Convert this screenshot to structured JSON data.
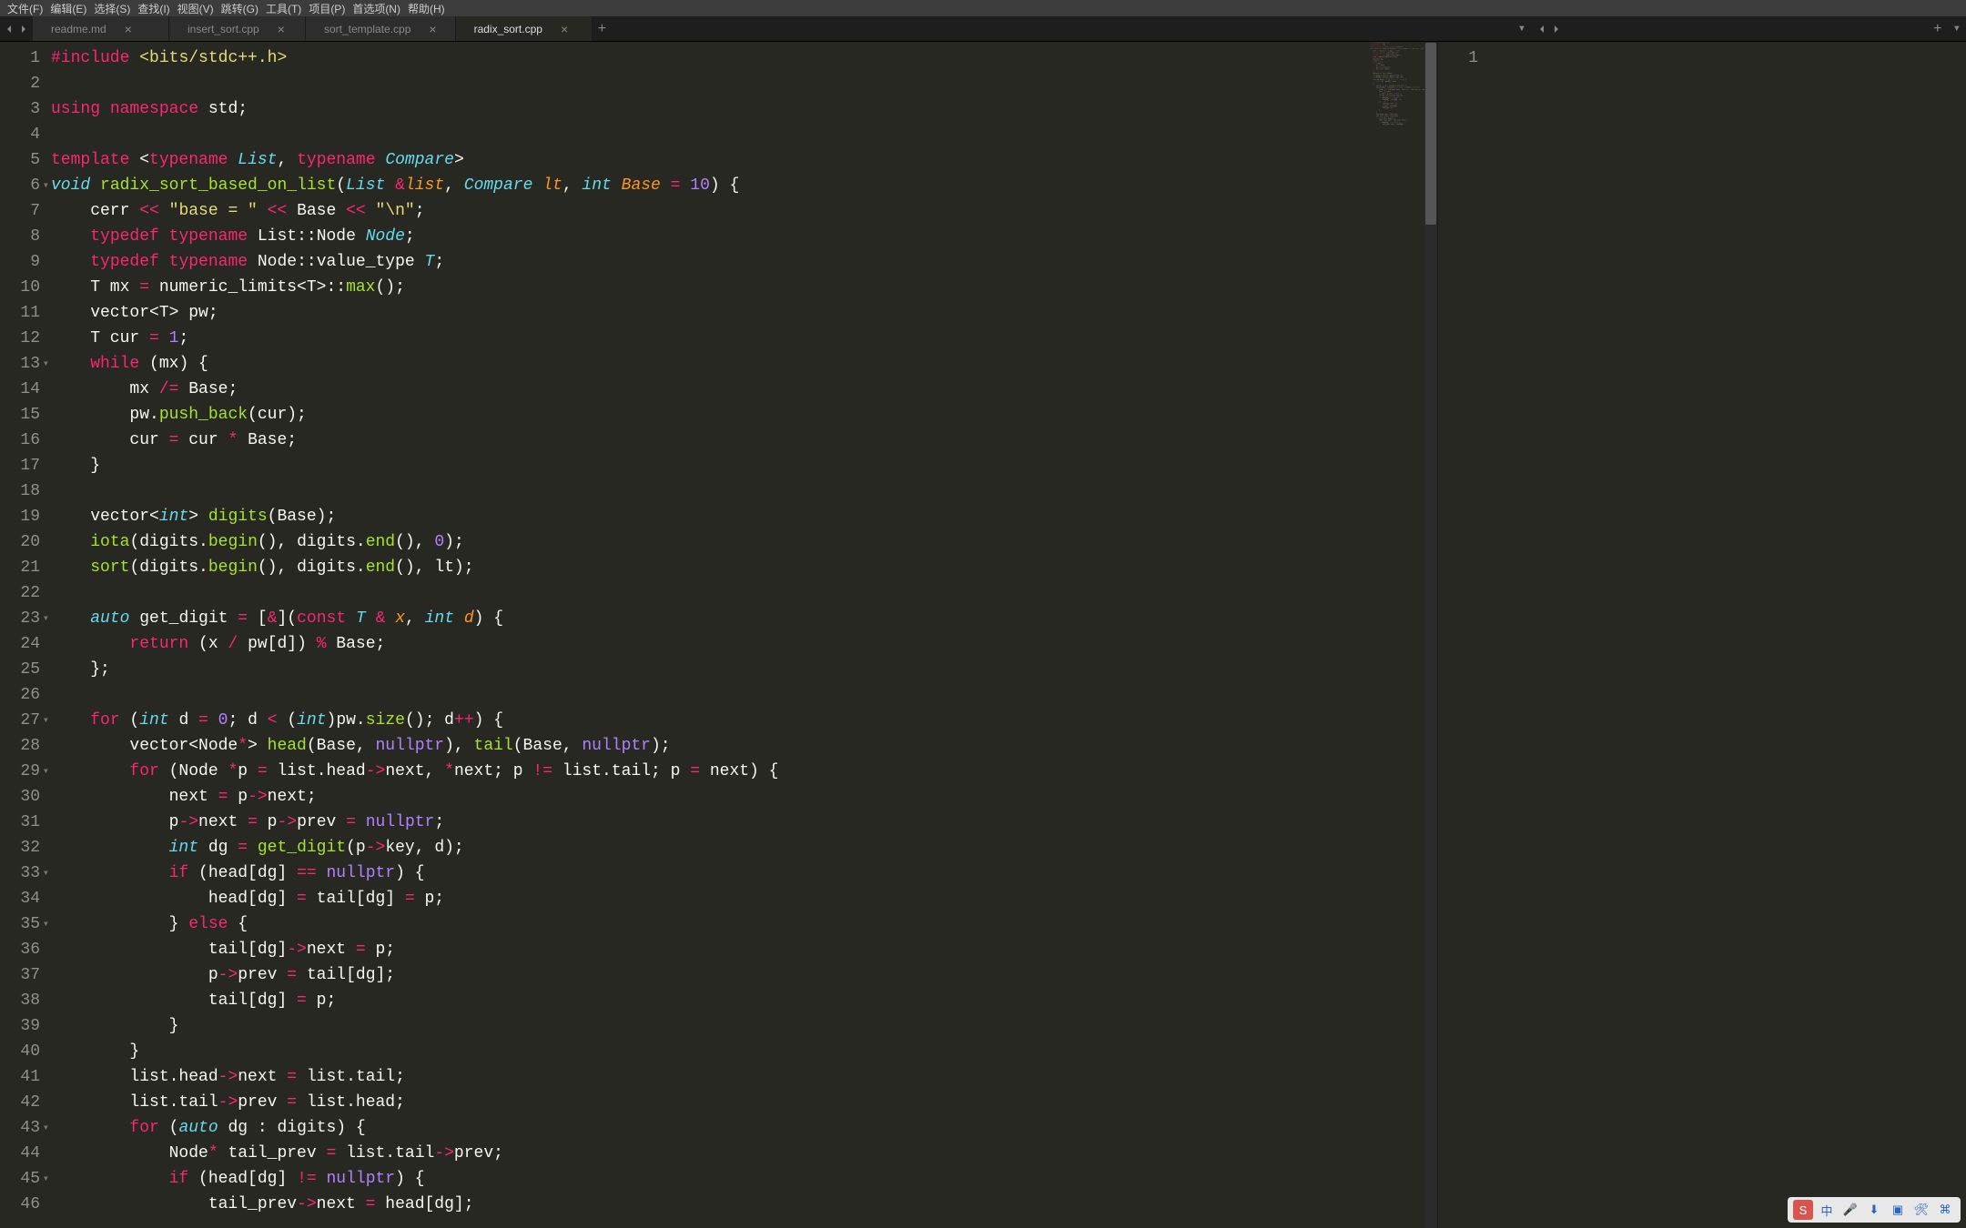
{
  "menu": {
    "items": [
      "文件(F)",
      "编辑(E)",
      "选择(S)",
      "查找(I)",
      "视图(V)",
      "跳转(G)",
      "工具(T)",
      "项目(P)",
      "首选项(N)",
      "帮助(H)"
    ]
  },
  "tabs": [
    {
      "label": "readme.md",
      "active": false
    },
    {
      "label": "insert_sort.cpp",
      "active": false
    },
    {
      "label": "sort_template.cpp",
      "active": false
    },
    {
      "label": "radix_sort.cpp",
      "active": true
    }
  ],
  "rightPane": {
    "lineNumbers": [
      "1"
    ]
  },
  "tray": {
    "ime": "S",
    "lang": "中",
    "icons": [
      "mic",
      "down",
      "screen",
      "tool",
      "grid"
    ]
  },
  "code": {
    "lines": [
      {
        "n": 1,
        "html": "<span class='c-pre'>#include</span> <span class='c-inc'>&lt;bits/stdc++.h&gt;</span>"
      },
      {
        "n": 2,
        "html": ""
      },
      {
        "n": 3,
        "html": "<span class='c-kw'>using</span> <span class='c-kw'>namespace</span> std;"
      },
      {
        "n": 4,
        "html": ""
      },
      {
        "n": 5,
        "html": "<span class='c-kw'>template</span> &lt;<span class='c-kw'>typename</span> <span class='c-type'>List</span>, <span class='c-kw'>typename</span> <span class='c-type'>Compare</span>&gt;"
      },
      {
        "n": 6,
        "fold": true,
        "html": "<span class='c-type'>void</span> <span class='c-fn'>radix_sort_based_on_list</span>(<span class='c-type'>List</span> <span class='c-op'>&amp;</span><span class='c-param'>list</span>, <span class='c-type'>Compare</span> <span class='c-param'>lt</span>, <span class='c-type'>int</span> <span class='c-param'>Base</span> <span class='c-op'>=</span> <span class='c-num'>10</span>) {"
      },
      {
        "n": 7,
        "html": "    cerr <span class='c-op'>&lt;&lt;</span> <span class='c-str'>\"base = \"</span> <span class='c-op'>&lt;&lt;</span> Base <span class='c-op'>&lt;&lt;</span> <span class='c-str'>\"\\n\"</span>;"
      },
      {
        "n": 8,
        "html": "    <span class='c-kw'>typedef</span> <span class='c-kw'>typename</span> List::Node <span class='c-type'>Node</span>;"
      },
      {
        "n": 9,
        "html": "    <span class='c-kw'>typedef</span> <span class='c-kw'>typename</span> Node::value_type <span class='c-type'>T</span>;"
      },
      {
        "n": 10,
        "html": "    T mx <span class='c-op'>=</span> numeric_limits&lt;T&gt;::<span class='c-fn'>max</span>();"
      },
      {
        "n": 11,
        "html": "    vector&lt;T&gt; pw;"
      },
      {
        "n": 12,
        "html": "    T cur <span class='c-op'>=</span> <span class='c-num'>1</span>;"
      },
      {
        "n": 13,
        "fold": true,
        "html": "    <span class='c-kw'>while</span> (mx) {"
      },
      {
        "n": 14,
        "html": "        mx <span class='c-op'>/=</span> Base;"
      },
      {
        "n": 15,
        "html": "        pw.<span class='c-fn'>push_back</span>(cur);"
      },
      {
        "n": 16,
        "html": "        cur <span class='c-op'>=</span> cur <span class='c-op'>*</span> Base;"
      },
      {
        "n": 17,
        "html": "    }"
      },
      {
        "n": 18,
        "html": ""
      },
      {
        "n": 19,
        "html": "    vector&lt;<span class='c-type'>int</span>&gt; <span class='c-fn'>digits</span>(Base);"
      },
      {
        "n": 20,
        "html": "    <span class='c-fn'>iota</span>(digits.<span class='c-fn'>begin</span>(), digits.<span class='c-fn'>end</span>(), <span class='c-num'>0</span>);"
      },
      {
        "n": 21,
        "html": "    <span class='c-fn'>sort</span>(digits.<span class='c-fn'>begin</span>(), digits.<span class='c-fn'>end</span>(), lt);"
      },
      {
        "n": 22,
        "html": ""
      },
      {
        "n": 23,
        "fold": true,
        "html": "    <span class='c-type'>auto</span> get_digit <span class='c-op'>=</span> [<span class='c-op'>&amp;</span>](<span class='c-kw'>const</span> <span class='c-type'>T</span> <span class='c-op'>&amp;</span> <span class='c-param'>x</span>, <span class='c-type'>int</span> <span class='c-param'>d</span>) {"
      },
      {
        "n": 24,
        "html": "        <span class='c-kw'>return</span> (x <span class='c-op'>/</span> pw[d]) <span class='c-op'>%</span> Base;"
      },
      {
        "n": 25,
        "html": "    };"
      },
      {
        "n": 26,
        "html": ""
      },
      {
        "n": 27,
        "fold": true,
        "html": "    <span class='c-kw'>for</span> (<span class='c-type'>int</span> d <span class='c-op'>=</span> <span class='c-num'>0</span>; d <span class='c-op'>&lt;</span> (<span class='c-type'>int</span>)pw.<span class='c-fn'>size</span>(); d<span class='c-op'>++</span>) {"
      },
      {
        "n": 28,
        "html": "        vector&lt;Node<span class='c-op'>*</span>&gt; <span class='c-fn'>head</span>(Base, <span class='c-num'>nullptr</span>), <span class='c-fn'>tail</span>(Base, <span class='c-num'>nullptr</span>);"
      },
      {
        "n": 29,
        "fold": true,
        "html": "        <span class='c-kw'>for</span> (Node <span class='c-op'>*</span>p <span class='c-op'>=</span> list.head<span class='c-op'>-&gt;</span>next, <span class='c-op'>*</span>next; p <span class='c-op'>!=</span> list.tail; p <span class='c-op'>=</span> next) {"
      },
      {
        "n": 30,
        "html": "            next <span class='c-op'>=</span> p<span class='c-op'>-&gt;</span>next;"
      },
      {
        "n": 31,
        "html": "            p<span class='c-op'>-&gt;</span>next <span class='c-op'>=</span> p<span class='c-op'>-&gt;</span>prev <span class='c-op'>=</span> <span class='c-num'>nullptr</span>;"
      },
      {
        "n": 32,
        "html": "            <span class='c-type'>int</span> dg <span class='c-op'>=</span> <span class='c-fn'>get_digit</span>(p<span class='c-op'>-&gt;</span>key, d);"
      },
      {
        "n": 33,
        "fold": true,
        "html": "            <span class='c-kw'>if</span> (head[dg] <span class='c-op'>==</span> <span class='c-num'>nullptr</span>) {"
      },
      {
        "n": 34,
        "html": "                head[dg] <span class='c-op'>=</span> tail[dg] <span class='c-op'>=</span> p;"
      },
      {
        "n": 35,
        "fold": true,
        "html": "            } <span class='c-kw'>else</span> {"
      },
      {
        "n": 36,
        "html": "                tail[dg]<span class='c-op'>-&gt;</span>next <span class='c-op'>=</span> p;"
      },
      {
        "n": 37,
        "html": "                p<span class='c-op'>-&gt;</span>prev <span class='c-op'>=</span> tail[dg];"
      },
      {
        "n": 38,
        "html": "                tail[dg] <span class='c-op'>=</span> p;"
      },
      {
        "n": 39,
        "html": "            }"
      },
      {
        "n": 40,
        "html": "        }"
      },
      {
        "n": 41,
        "html": "        list.head<span class='c-op'>-&gt;</span>next <span class='c-op'>=</span> list.tail;"
      },
      {
        "n": 42,
        "html": "        list.tail<span class='c-op'>-&gt;</span>prev <span class='c-op'>=</span> list.head;"
      },
      {
        "n": 43,
        "fold": true,
        "html": "        <span class='c-kw'>for</span> (<span class='c-type'>auto</span> dg : digits) {"
      },
      {
        "n": 44,
        "html": "            Node<span class='c-op'>*</span> tail_prev <span class='c-op'>=</span> list.tail<span class='c-op'>-&gt;</span>prev;"
      },
      {
        "n": 45,
        "fold": true,
        "html": "            <span class='c-kw'>if</span> (head[dg] <span class='c-op'>!=</span> <span class='c-num'>nullptr</span>) {"
      },
      {
        "n": 46,
        "html": "                tail_prev<span class='c-op'>-&gt;</span>next <span class='c-op'>=</span> head[dg];"
      }
    ]
  }
}
